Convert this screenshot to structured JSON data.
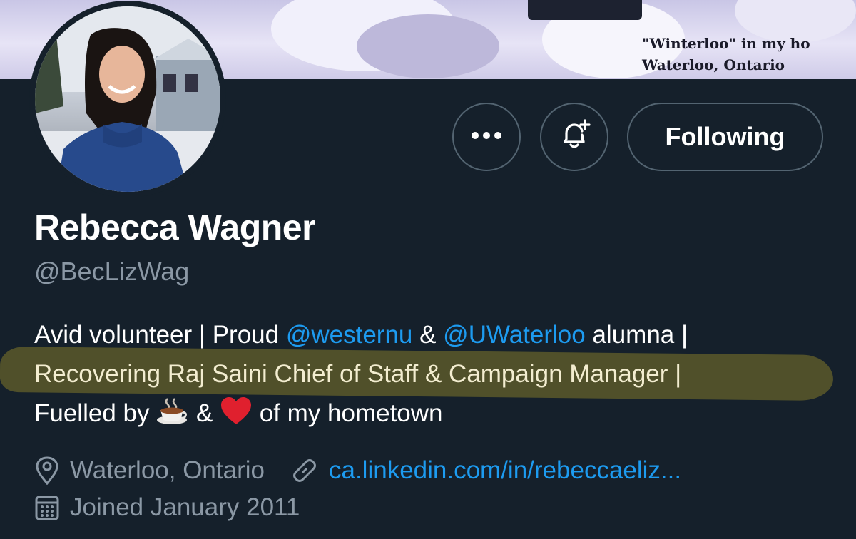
{
  "banner": {
    "caption_line1": "\"Winterloo\" in my ho",
    "caption_line2": "Waterloo, Ontario"
  },
  "profile": {
    "name": "Rebecca Wagner",
    "handle": "@BecLizWag"
  },
  "actions": {
    "more_icon": "more-horizontal-icon",
    "notify_icon": "bell-plus-icon",
    "following_label": "Following"
  },
  "bio": {
    "line1_a": "Avid volunteer | Proud ",
    "line1_mention1": "@westernu",
    "line1_b": " & ",
    "line1_mention2": "@UWaterloo",
    "line1_c": " alumna |",
    "line2": "Recovering Raj Saini Chief of Staff & Campaign Manager |",
    "line3_a": "Fuelled by ",
    "line3_b": " & ",
    "line3_c": " of my hometown",
    "emoji1": "coffee-icon",
    "emoji2": "red-heart-icon"
  },
  "meta": {
    "location": "Waterloo, Ontario",
    "website": "ca.linkedin.com/in/rebeccaeliz...",
    "joined": "Joined January 2011"
  },
  "colors": {
    "background": "#15202b",
    "accent": "#1d9bf0",
    "secondary_text": "#8b98a5",
    "highlight": "#cdb928"
  }
}
